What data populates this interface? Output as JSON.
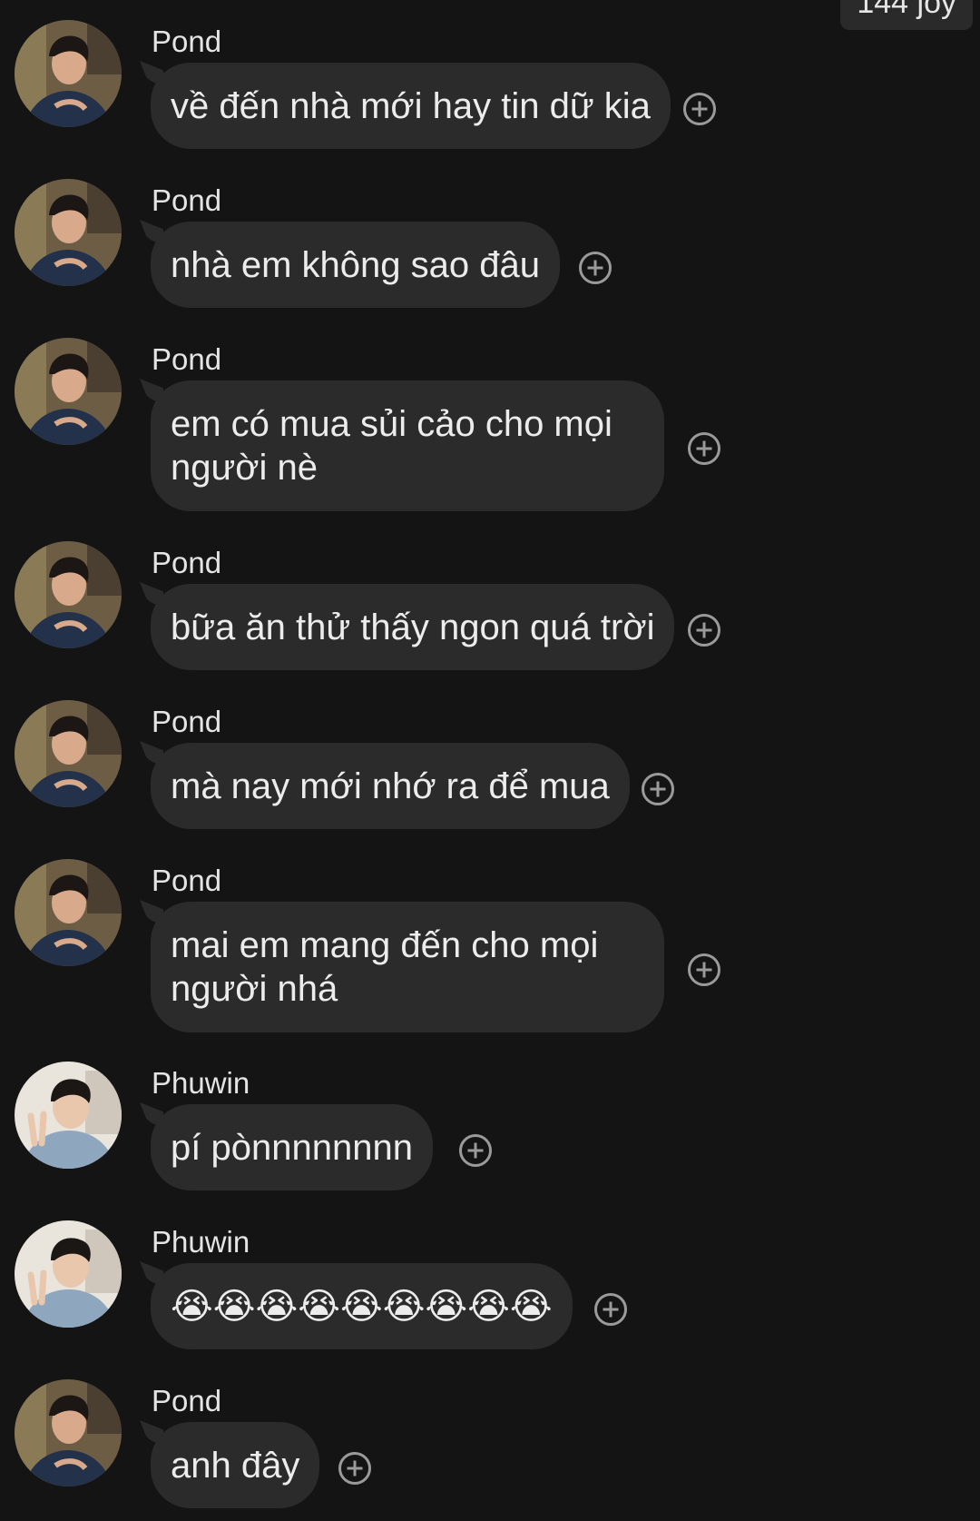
{
  "top_badge": "144 joy",
  "messages": [
    {
      "sender": "Pond",
      "text": "về đến nhà mới hay tin dữ kia",
      "avatar": "pond-avatar"
    },
    {
      "sender": "Pond",
      "text": "nhà em không sao đâu",
      "avatar": "pond-avatar"
    },
    {
      "sender": "Pond",
      "text": "em có mua sủi cảo cho mọi người nè",
      "avatar": "pond-avatar"
    },
    {
      "sender": "Pond",
      "text": "bữa ăn thử thấy ngon quá trời",
      "avatar": "pond-avatar"
    },
    {
      "sender": "Pond",
      "text": "mà nay mới nhớ ra để mua",
      "avatar": "pond-avatar"
    },
    {
      "sender": "Pond",
      "text": "mai em mang đến cho mọi người nhá",
      "avatar": "pond-avatar"
    },
    {
      "sender": "Phuwin",
      "text": "pí pònnnnnnnn",
      "avatar": "phuwin-avatar"
    },
    {
      "sender": "Phuwin",
      "text": "😭😭😭😭😭😭😭😭😭",
      "avatar": "phuwin-avatar"
    },
    {
      "sender": "Pond",
      "text": "anh đây",
      "avatar": "pond-avatar"
    }
  ],
  "colors": {
    "background": "#141414",
    "bubble": "#2b2b2c",
    "text": "#ececec",
    "icon": "#9a9a9a"
  },
  "icons": {
    "reaction": "add-reaction-icon"
  }
}
